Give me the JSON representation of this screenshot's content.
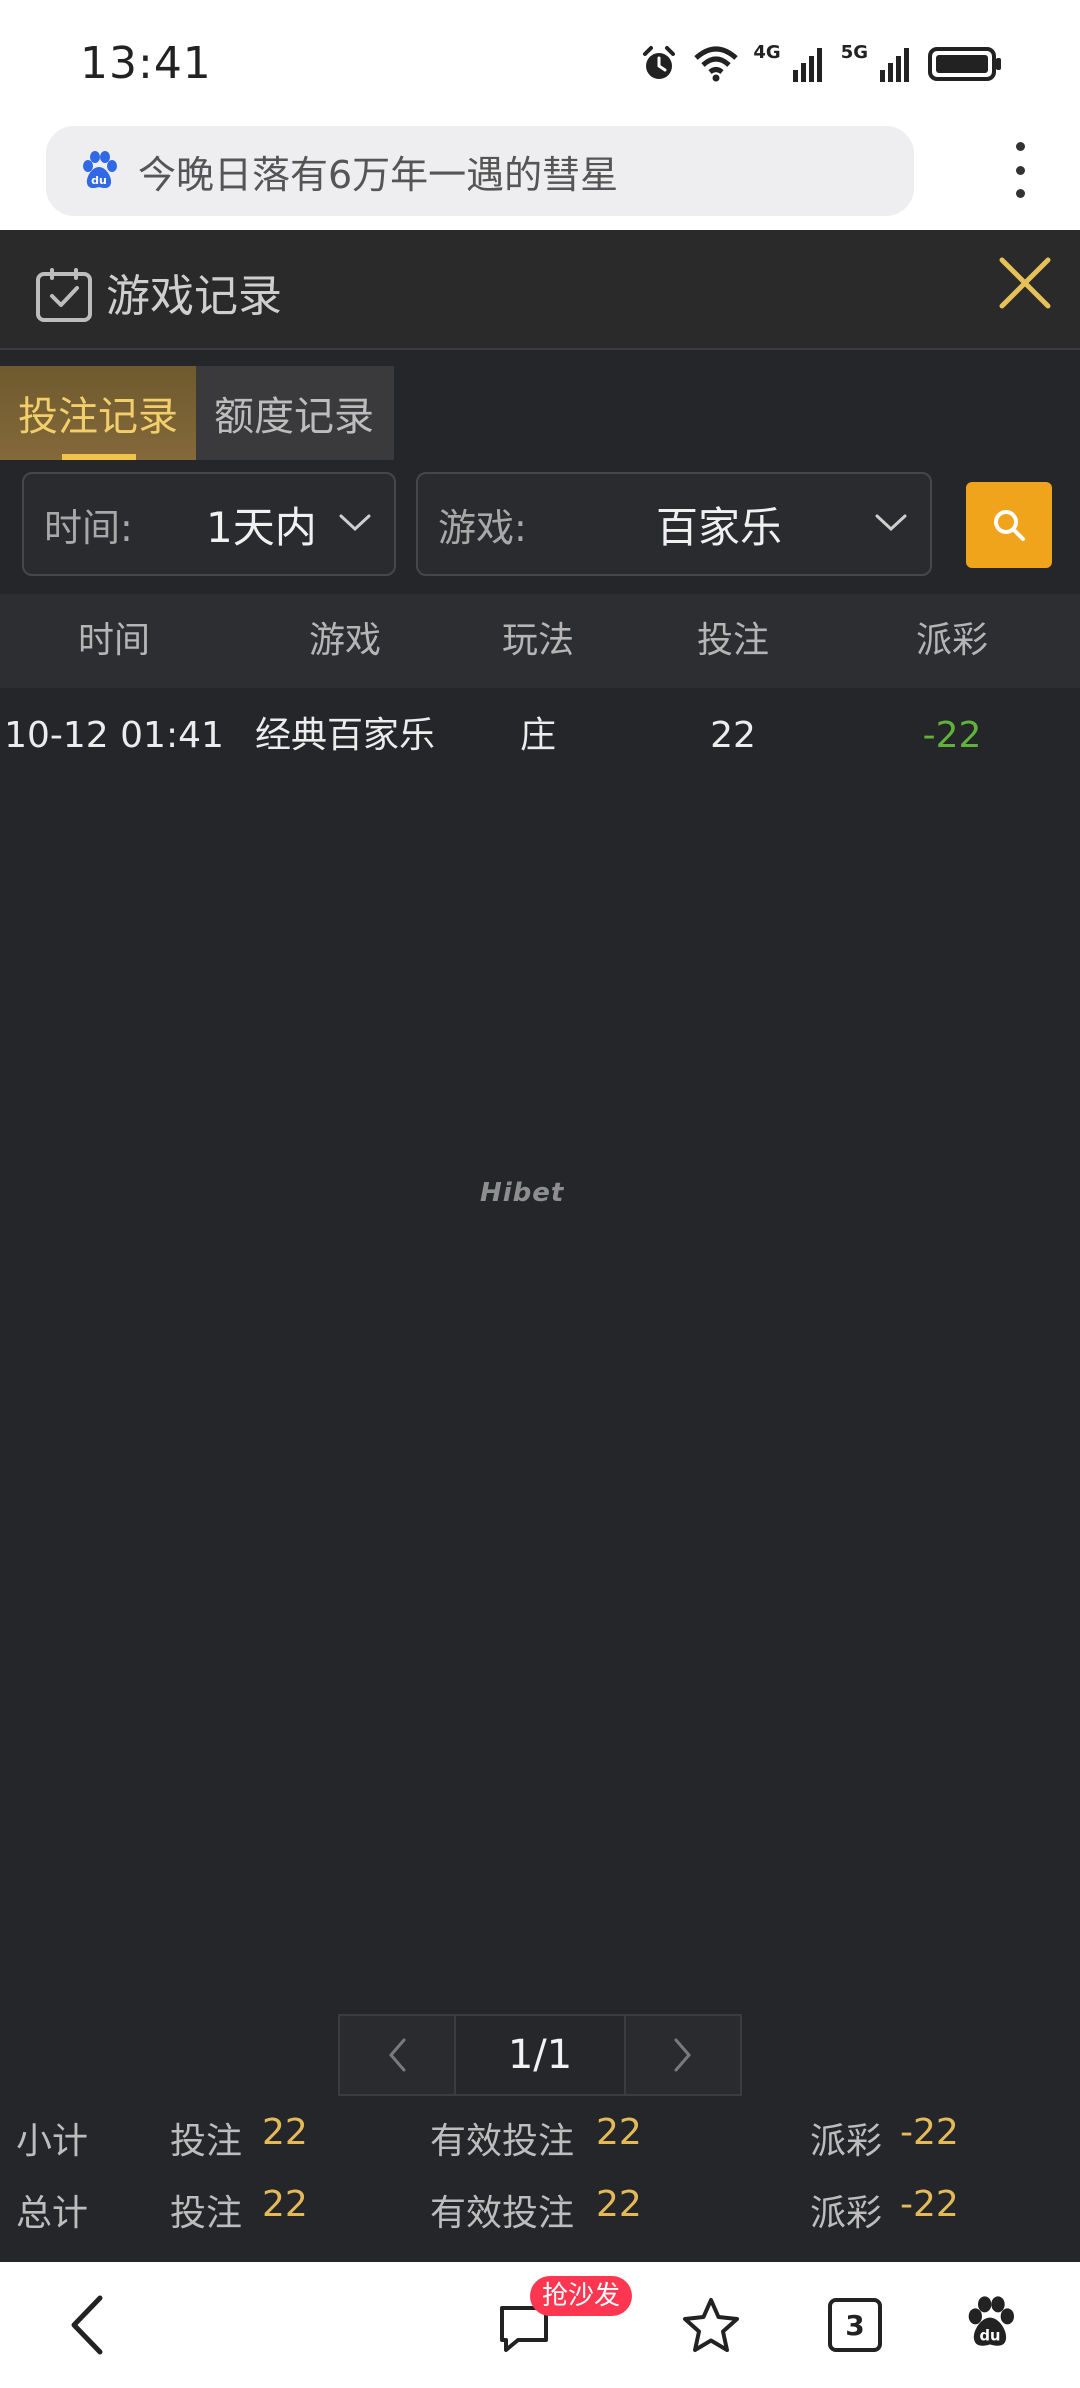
{
  "status_bar": {
    "time": "13:41",
    "net1": "4G",
    "net2": "5G"
  },
  "search": {
    "text": "今晚日落有6万年一遇的彗星"
  },
  "modal": {
    "title": "游戏记录"
  },
  "tabs": [
    {
      "label": "投注记录",
      "active": true
    },
    {
      "label": "额度记录",
      "active": false
    }
  ],
  "filters": {
    "time_label": "时间:",
    "time_value": "1天内",
    "game_label": "游戏:",
    "game_value": "百家乐"
  },
  "table": {
    "headers": [
      "时间",
      "游戏",
      "玩法",
      "投注",
      "派彩"
    ],
    "rows": [
      {
        "time": "10-12 01:41",
        "game": "经典百家乐",
        "play": "庄",
        "bet": "22",
        "payout": "-22"
      }
    ]
  },
  "watermark": "Hibet",
  "pagination": {
    "page": "1/1"
  },
  "summary": {
    "subtotal": {
      "label": "小计",
      "bet_label": "投注",
      "bet": "22",
      "valid_label": "有效投注",
      "valid": "22",
      "payout_label": "派彩",
      "payout": "-22"
    },
    "total": {
      "label": "总计",
      "bet_label": "投注",
      "bet": "22",
      "valid_label": "有效投注",
      "valid": "22",
      "payout_label": "派彩",
      "payout": "-22"
    }
  },
  "bottom_bar": {
    "comment_badge": "抢沙发",
    "tabs_count": "3"
  },
  "colors": {
    "accent": "#f0a41c",
    "gold_text": "#e4b95a",
    "negative": "#5fb33a",
    "background": "#252629"
  }
}
